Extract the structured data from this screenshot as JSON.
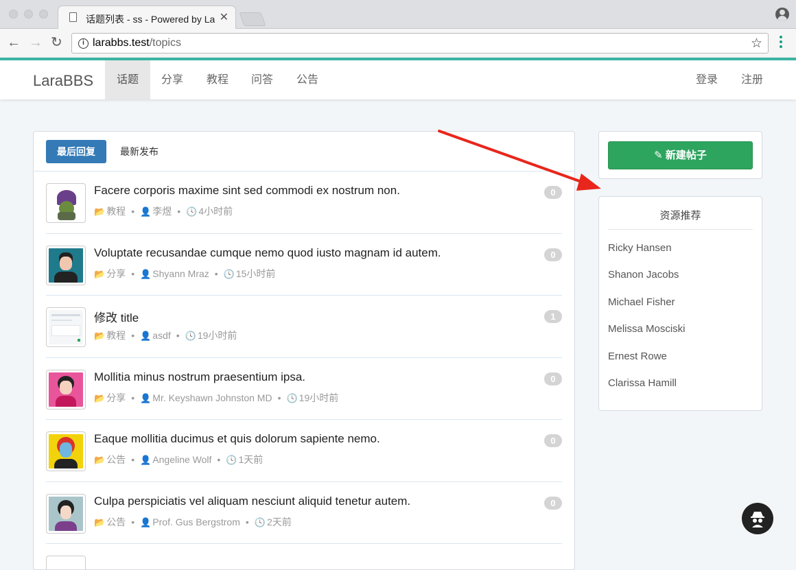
{
  "browser": {
    "tab_title": "话题列表 - ss - Powered by Lar",
    "url_host": "larabbs.test",
    "url_path": "/topics"
  },
  "site": {
    "brand": "LaraBBS",
    "nav": [
      {
        "label": "话题",
        "active": true
      },
      {
        "label": "分享"
      },
      {
        "label": "教程"
      },
      {
        "label": "问答"
      },
      {
        "label": "公告"
      }
    ],
    "login": "登录",
    "register": "注册"
  },
  "list": {
    "tabs": {
      "active": "最后回复",
      "other": "最新发布"
    },
    "topics": [
      {
        "title": "Facere corporis maxime sint sed commodi ex nostrum non.",
        "category": "教程",
        "author": "李煜",
        "time": "4小时前",
        "replies": "0"
      },
      {
        "title": "Voluptate recusandae cumque nemo quod iusto magnam id autem.",
        "category": "分享",
        "author": "Shyann Mraz",
        "time": "15小时前",
        "replies": "0"
      },
      {
        "title": "修改 title",
        "category": "教程",
        "author": "asdf",
        "time": "19小时前",
        "replies": "1"
      },
      {
        "title": "Mollitia minus nostrum praesentium ipsa.",
        "category": "分享",
        "author": "Mr. Keyshawn Johnston MD",
        "time": "19小时前",
        "replies": "0"
      },
      {
        "title": "Eaque mollitia ducimus et quis dolorum sapiente nemo.",
        "category": "公告",
        "author": "Angeline Wolf",
        "time": "1天前",
        "replies": "0"
      },
      {
        "title": "Culpa perspiciatis vel aliquam nesciunt aliquid tenetur autem.",
        "category": "公告",
        "author": "Prof. Gus Bergstrom",
        "time": "2天前",
        "replies": "0"
      }
    ]
  },
  "sidebar": {
    "new_topic": "新建帖子",
    "resources_title": "资源推荐",
    "resources": [
      "Ricky Hansen",
      "Shanon Jacobs",
      "Michael Fisher",
      "Melissa Mosciski",
      "Ernest Rowe",
      "Clarissa Hamill"
    ]
  },
  "colors": {
    "accent": "#3bb4a3",
    "primary": "#337ab7",
    "success": "#2ea55f",
    "annotation_arrow": "#e8261c"
  }
}
